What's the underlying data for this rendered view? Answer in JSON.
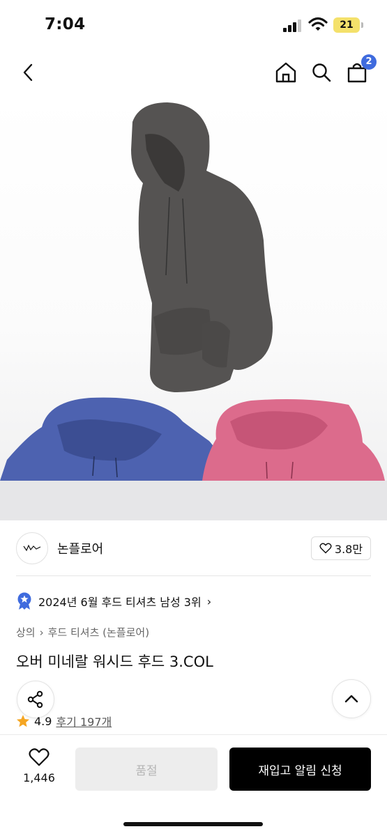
{
  "status_bar": {
    "time": "7:04",
    "battery": "21",
    "battery_color": "#f4e16b"
  },
  "nav": {
    "cart_count": "2",
    "badge_color": "#3f6bde",
    "icons": [
      "back-icon",
      "home-icon",
      "search-icon",
      "cart-icon"
    ]
  },
  "hero": {
    "description_colors": [
      "#555352",
      "#4d62b0",
      "#dc6b8c"
    ]
  },
  "brand": {
    "name": "논플로어",
    "likes": "3.8만"
  },
  "ranking": {
    "text": "2024년 6월 후드 티셔츠 남성 3위",
    "badge_color": "#3f6bde"
  },
  "breadcrumb": {
    "items": [
      "상의",
      "후드 티셔츠 (논플로어)"
    ]
  },
  "product": {
    "title": "오버 미네랄 워시드 후드 3.COL",
    "rating": "4.9",
    "reviews": "후기 197개"
  },
  "bottom_bar": {
    "wish_count": "1,446",
    "soldout_label": "품절",
    "restock_label": "재입고 알림 신청"
  }
}
